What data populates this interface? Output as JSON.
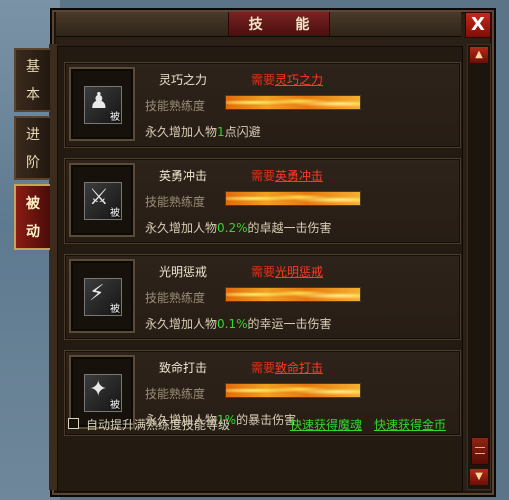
{
  "window": {
    "title": "技 能",
    "close_label": "X"
  },
  "tabs": [
    {
      "label_top": "基",
      "label_bottom": "本",
      "active": false
    },
    {
      "label_top": "进",
      "label_bottom": "阶",
      "active": false
    },
    {
      "label_top": "被",
      "label_bottom": "动",
      "active": true
    }
  ],
  "skills": [
    {
      "name": "灵巧之力",
      "req_prefix": "需要",
      "req_name": "灵巧之力",
      "prof_label": "技能熟练度",
      "progress": 1.0,
      "desc_prefix": "永久增加人物",
      "desc_value": "1",
      "desc_suffix": "点闪避",
      "icon": "figure-icon",
      "icon_glyph": "♟",
      "badge": "被"
    },
    {
      "name": "英勇冲击",
      "req_prefix": "需要",
      "req_name": "英勇冲击",
      "prof_label": "技能熟练度",
      "progress": 1.0,
      "desc_prefix": "永久增加人物",
      "desc_value": "0.2%",
      "desc_suffix": "的卓越一击伤害",
      "icon": "slash-icon",
      "icon_glyph": "⚔",
      "badge": "被"
    },
    {
      "name": "光明惩戒",
      "req_prefix": "需要",
      "req_name": "光明惩戒",
      "prof_label": "技能熟练度",
      "progress": 1.0,
      "desc_prefix": "永久增加人物",
      "desc_value": "0.1%",
      "desc_suffix": "的幸运一击伤害",
      "icon": "blade-icon",
      "icon_glyph": "⚡",
      "badge": "被"
    },
    {
      "name": "致命打击",
      "req_prefix": "需要",
      "req_name": "致命打击",
      "prof_label": "技能熟练度",
      "progress": 1.0,
      "desc_prefix": "永久增加人物",
      "desc_value": "1%",
      "desc_suffix": "的暴击伤害",
      "icon": "strike-icon",
      "icon_glyph": "✦",
      "badge": "被"
    }
  ],
  "footer": {
    "auto_label": "自动提升满熟练度技能等级",
    "link1": "快速获得魔魂",
    "link2": "快速获得金币"
  },
  "scroll": {
    "up": "▲",
    "down": "▼"
  }
}
